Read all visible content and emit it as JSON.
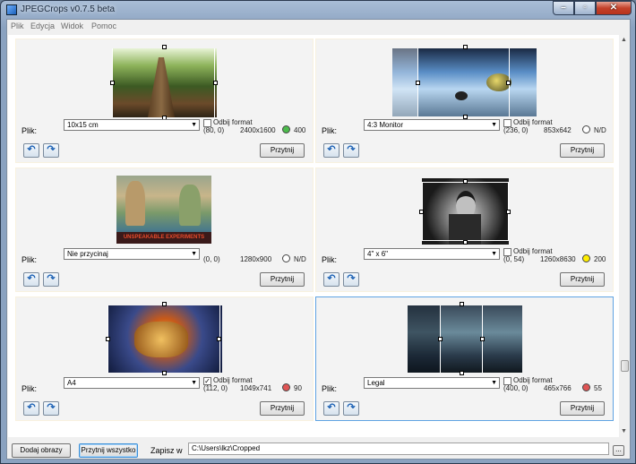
{
  "window": {
    "title": "JPEGCrops v0.7.5 beta"
  },
  "menu": [
    "Plik",
    "Edycja",
    "Widok",
    "Pomoc"
  ],
  "panel_common": {
    "file_label": "Plik:",
    "flip_label": "Odbij format",
    "crop_button": "Przytnij"
  },
  "panels": [
    {
      "format": "10x15 cm",
      "offset": "(80, 0)",
      "size": "2400x1600",
      "status_color": "#4cbb4c",
      "quality": "400",
      "flip": false
    },
    {
      "format": "4:3 Monitor",
      "offset": "(236, 0)",
      "size": "853x642",
      "status_color": "#ffffff",
      "quality": "N/D",
      "flip": false
    },
    {
      "format": "Nie przycinaj",
      "offset": "(0, 0)",
      "size": "1280x900",
      "status_color": "#ffffff",
      "quality": "N/D",
      "flip": null
    },
    {
      "format": "4\" x 6\"",
      "offset": "(0, 54)",
      "size": "1260x8630",
      "status_color": "#ffee00",
      "quality": "200",
      "flip": false
    },
    {
      "format": "A4",
      "offset": "(112, 0)",
      "size": "1049x741",
      "status_color": "#e05555",
      "quality": "90",
      "flip": true
    },
    {
      "format": "Legal",
      "offset": "(400, 0)",
      "size": "465x766",
      "status_color": "#e05555",
      "quality": "55",
      "flip": false
    }
  ],
  "bottom": {
    "add_images": "Dodaj obrazy",
    "crop_all": "Przytnij wszystko",
    "save_to_label": "Zapisz w",
    "save_path": "C:\\Users\\lkz\\Cropped",
    "browse": "..."
  }
}
